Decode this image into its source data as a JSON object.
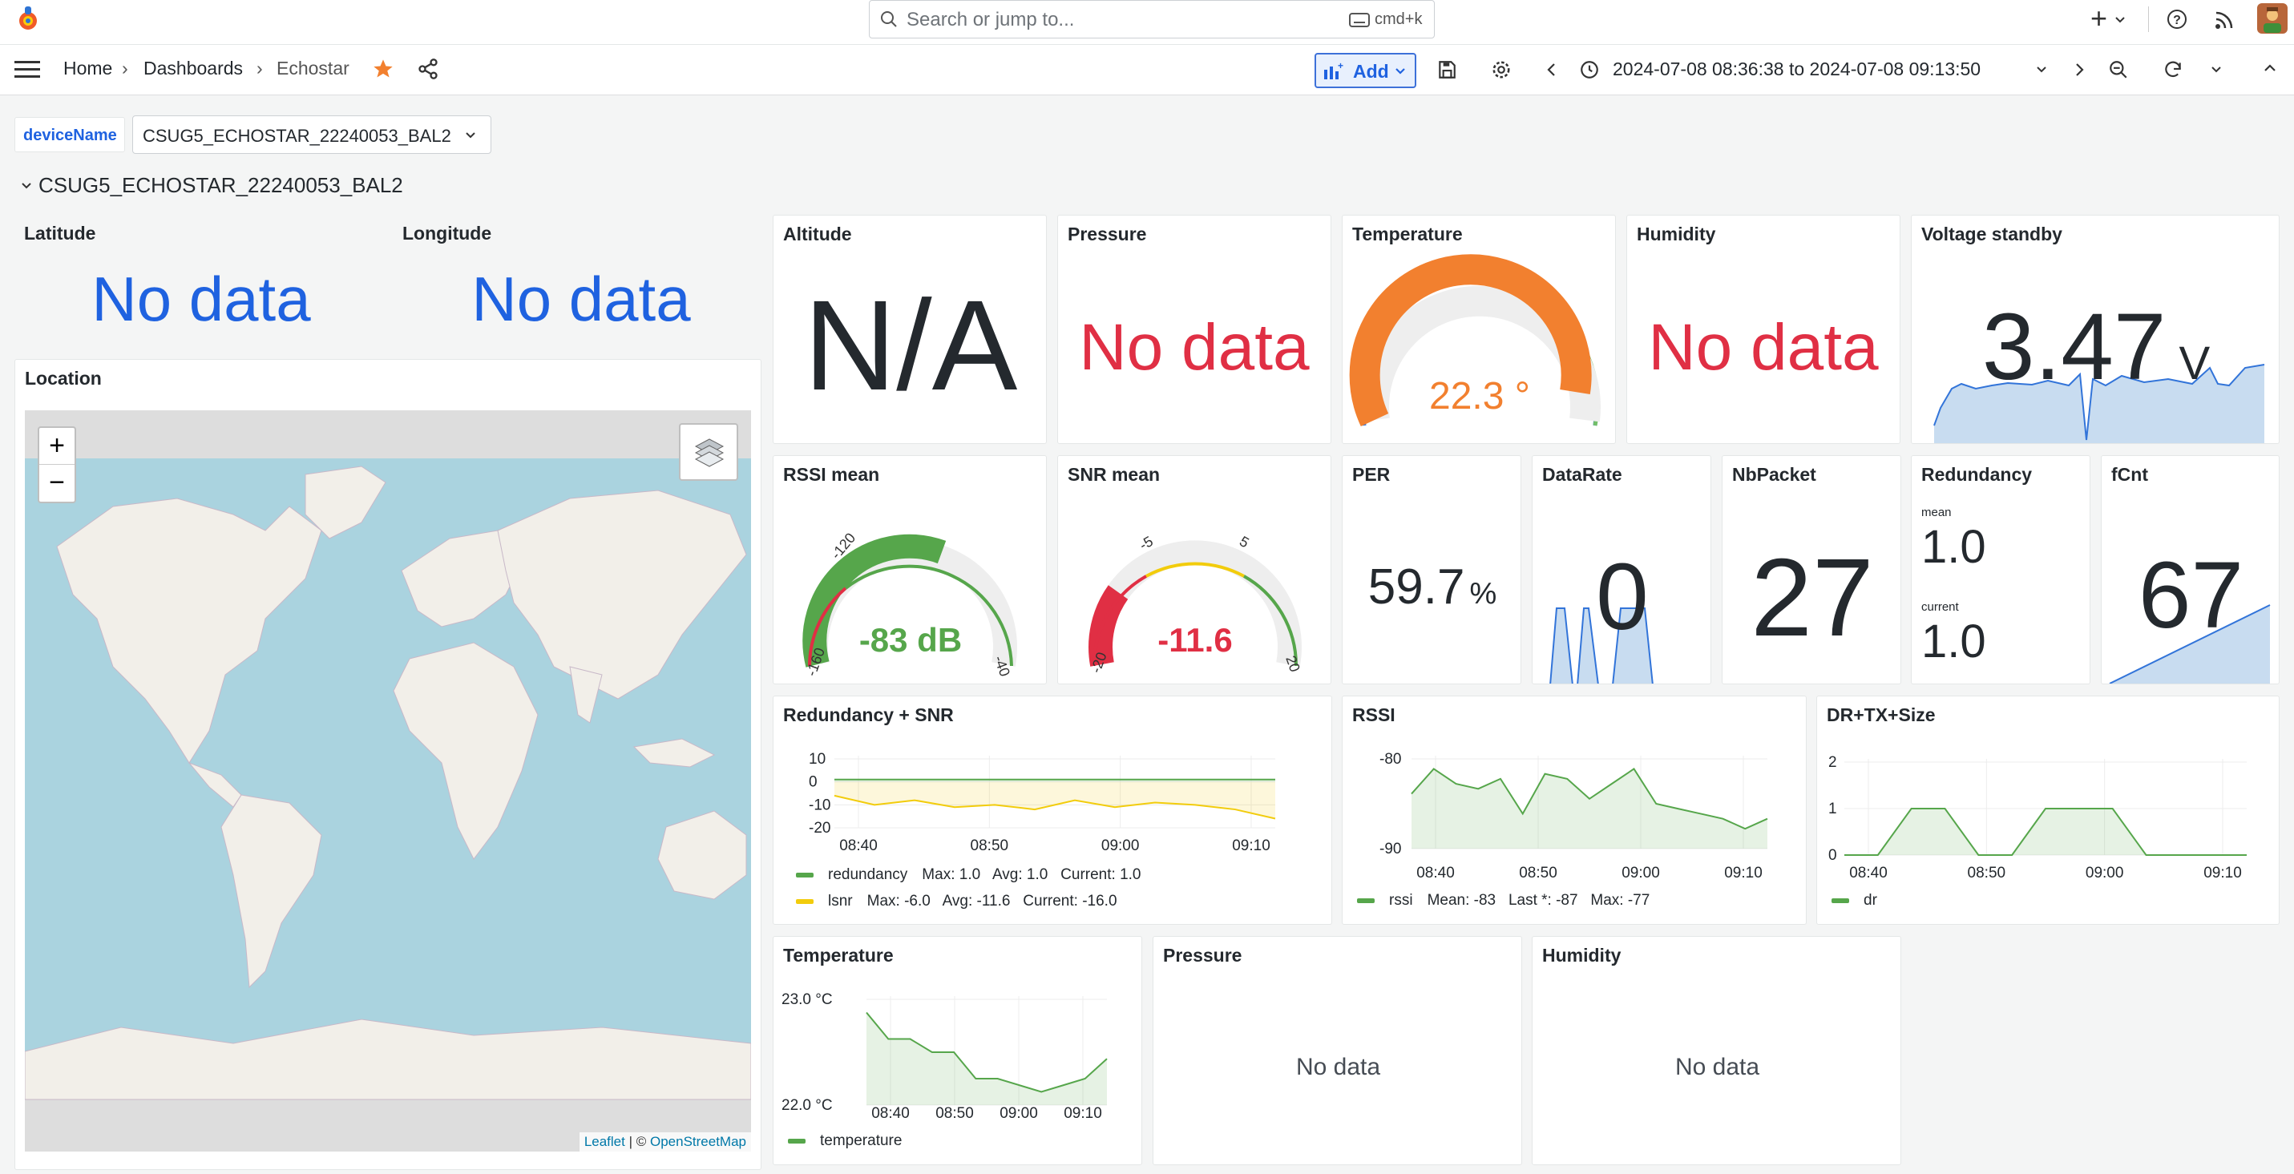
{
  "topbar": {
    "search_placeholder": "Search or jump to...",
    "search_shortcut": "cmd+k",
    "plus": "+"
  },
  "nav": {
    "breadcrumbs": [
      "Home",
      "Dashboards",
      "Echostar"
    ],
    "add_label": "Add",
    "time_range": "2024-07-08 08:36:38 to 2024-07-08 09:13:50"
  },
  "variable": {
    "label": "deviceName",
    "value": "CSUG5_ECHOSTAR_22240053_BAL2"
  },
  "row": {
    "title": "CSUG5_ECHOSTAR_22240053_BAL2"
  },
  "panels": {
    "latitude": {
      "title": "Latitude",
      "value": "No data"
    },
    "longitude": {
      "title": "Longitude",
      "value": "No data"
    },
    "location": {
      "title": "Location",
      "zoom_in": "+",
      "zoom_out": "−",
      "attribution_leaflet": "Leaflet",
      "attribution_sep": " | © ",
      "attribution_osm": "OpenStreetMap"
    },
    "altitude": {
      "title": "Altitude",
      "value": "N/A"
    },
    "pressure_stat": {
      "title": "Pressure",
      "value": "No data"
    },
    "temperature_gauge": {
      "title": "Temperature",
      "value": "22.3 °",
      "fraction": 0.87
    },
    "humidity_stat": {
      "title": "Humidity",
      "value": "No data"
    },
    "voltage": {
      "title": "Voltage standby",
      "value": "3.47",
      "unit": "V"
    },
    "rssi_mean": {
      "title": "RSSI mean",
      "value": "-83 dB",
      "min_label": "-160",
      "tick1": "-120",
      "max_label": "-40",
      "fraction": 0.6
    },
    "snr_mean": {
      "title": "SNR mean",
      "value": "-11.6",
      "min_label": "-20",
      "tick1": "-5",
      "tick2": "5",
      "max_label": "20"
    },
    "per": {
      "title": "PER",
      "value": "59.7",
      "unit": "%"
    },
    "datarate": {
      "title": "DataRate",
      "value": "0"
    },
    "nbpacket": {
      "title": "NbPacket",
      "value": "27"
    },
    "redundancy": {
      "title": "Redundancy",
      "mean_label": "mean",
      "mean_value": "1.0",
      "current_label": "current",
      "current_value": "1.0"
    },
    "fcnt": {
      "title": "fCnt",
      "value": "67"
    },
    "redundancy_snr": {
      "title": "Redundancy + SNR",
      "legend1": {
        "name": "redundancy",
        "stats": "Max: 1.0   Avg: 1.0   Current: 1.0"
      },
      "legend2": {
        "name": "lsnr",
        "stats": "Max: -6.0   Avg: -11.6   Current: -16.0"
      }
    },
    "rssi": {
      "title": "RSSI",
      "legend": {
        "name": "rssi",
        "stats": "Mean: -83   Last *: -87   Max: -77"
      }
    },
    "dr_tx_size": {
      "title": "DR+TX+Size",
      "legend": {
        "name": "dr"
      }
    },
    "temperature_ts": {
      "title": "Temperature",
      "legend": {
        "name": "temperature"
      }
    },
    "pressure_ts": {
      "title": "Pressure",
      "value": "No data"
    },
    "humidity_ts": {
      "title": "Humidity",
      "value": "No data"
    }
  },
  "colors": {
    "blue": "#1f62e0",
    "red": "#e02f44",
    "green": "#56a64b",
    "orange": "#f2802f",
    "yellow": "#f2cc0c",
    "fill_blue": "#c8dcf0",
    "line_blue": "#3274d9"
  },
  "chart_data": [
    {
      "type": "line",
      "panel": "redundancy_snr",
      "x_ticks": [
        "08:40",
        "08:50",
        "09:00",
        "09:10"
      ],
      "y_ticks": [
        10,
        0,
        -10,
        -20
      ],
      "ylim": [
        -20,
        10
      ],
      "series": [
        {
          "name": "redundancy",
          "color": "#56a64b",
          "values": [
            1,
            1,
            1,
            1,
            1,
            1,
            1,
            1,
            1,
            1,
            1,
            1
          ]
        },
        {
          "name": "lsnr",
          "color": "#f2cc0c",
          "values": [
            -6,
            -10,
            -8,
            -11,
            -10,
            -12,
            -8,
            -11,
            -9,
            -10,
            -12,
            -16
          ]
        }
      ]
    },
    {
      "type": "area",
      "panel": "rssi",
      "x_ticks": [
        "08:40",
        "08:50",
        "09:00",
        "09:10"
      ],
      "y_ticks": [
        -80,
        -90
      ],
      "ylim": [
        -93,
        -75
      ],
      "series": [
        {
          "name": "rssi",
          "color": "#56a64b",
          "values": [
            -82,
            -77,
            -80,
            -81,
            -79,
            -86,
            -78,
            -79,
            -83,
            -80,
            -77,
            -84,
            -85,
            -86,
            -87,
            -89,
            -87
          ]
        }
      ]
    },
    {
      "type": "area",
      "panel": "dr_tx_size",
      "x_ticks": [
        "08:40",
        "08:50",
        "09:00",
        "09:10"
      ],
      "y_ticks": [
        2,
        1,
        0
      ],
      "ylim": [
        0,
        2
      ],
      "series": [
        {
          "name": "dr",
          "color": "#56a64b",
          "values": [
            0,
            0,
            1,
            1,
            0,
            0,
            1,
            1,
            1,
            0,
            0,
            0,
            0
          ]
        }
      ]
    },
    {
      "type": "area",
      "panel": "temperature_ts",
      "x_ticks": [
        "08:40",
        "08:50",
        "09:00",
        "09:10"
      ],
      "y_ticks": [
        "23.0 °C",
        "22.0 °C"
      ],
      "ylim": [
        21.6,
        23.2
      ],
      "series": [
        {
          "name": "temperature",
          "color": "#56a64b",
          "values": [
            23.0,
            22.6,
            22.6,
            22.4,
            22.4,
            22.0,
            22.0,
            21.9,
            21.8,
            21.9,
            22.0,
            22.3
          ]
        }
      ]
    }
  ]
}
